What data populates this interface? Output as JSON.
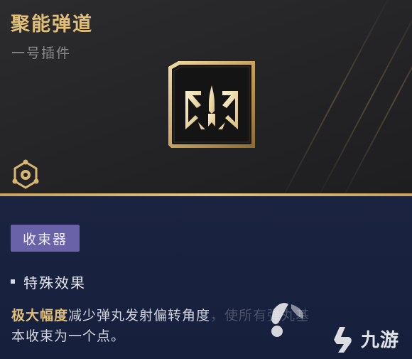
{
  "item": {
    "name": "聚能弹道",
    "subtype": "一号插件",
    "icon": "arrowhead-emblem-icon",
    "settings_icon": "gear-icon"
  },
  "details": {
    "category": "收束器",
    "section_title": "特殊效果",
    "effect_highlight": "极大幅度",
    "effect_text_1": "减少弹丸发射偏转角度",
    "effect_text_faded": "，使所有弹丸基",
    "effect_text_2": "本收束为一个点。"
  },
  "watermark": {
    "text": "九游"
  },
  "colors": {
    "gold": "#e2bf76",
    "badge": "#6a62a8",
    "top_bg": "#2a2a2c",
    "bottom_bg": "#18203a"
  }
}
